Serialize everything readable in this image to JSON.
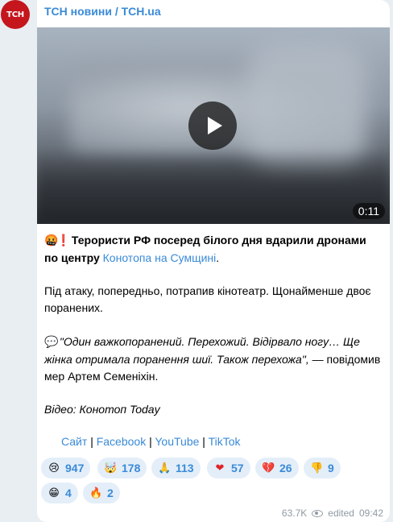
{
  "avatar": {
    "text": "ТСН"
  },
  "channel": {
    "name": "ТСН новини / ТСН.ua"
  },
  "video": {
    "duration": "0:11"
  },
  "post": {
    "headline_emoji": "🤬❗",
    "headline_bold": "Терористи РФ посеред білого дня вдарили дронами по центру",
    "headline_link": "Конотопа на Сумщині",
    "headline_end": ".",
    "para2": "Під атаку, попередньо, потрапив кінотеатр. Щонайменше двоє поранених.",
    "quote_emoji": "💬",
    "quote_italic": "\"Один важкопоранений. Перехожий. Відірвало ногу… Ще жінка отримала поранення шиї. Також перехожа\",",
    "quote_rest": " — повідомив мер Артем Семеніхін.",
    "video_credit": "Відео: Конотоп Today",
    "links": [
      "Сайт",
      "Facebook",
      "YouTube",
      "TikTok"
    ],
    "link_sep": "|"
  },
  "reactions": [
    {
      "icon": "crying-face-icon",
      "glyph": "😢",
      "count": "947"
    },
    {
      "icon": "exploding-head-icon",
      "glyph": "🤯",
      "count": "178"
    },
    {
      "icon": "praying-hands-icon",
      "glyph": "🙏",
      "count": "113"
    },
    {
      "icon": "red-heart-icon",
      "glyph": "❤",
      "count": "57"
    },
    {
      "icon": "broken-heart-icon",
      "glyph": "💔",
      "count": "26"
    },
    {
      "icon": "thumbs-down-icon",
      "glyph": "👎",
      "count": "9"
    },
    {
      "icon": "grimacing-face-icon",
      "glyph": "😁",
      "count": "4"
    },
    {
      "icon": "fire-icon",
      "glyph": "🔥",
      "count": "2"
    }
  ],
  "footer": {
    "views": "63.7K",
    "edited": "edited",
    "time": "09:42"
  },
  "colors": {
    "accent": "#3a8ad7",
    "avatar_bg": "#c4161c",
    "reaction_bg": "#e3eef9"
  }
}
